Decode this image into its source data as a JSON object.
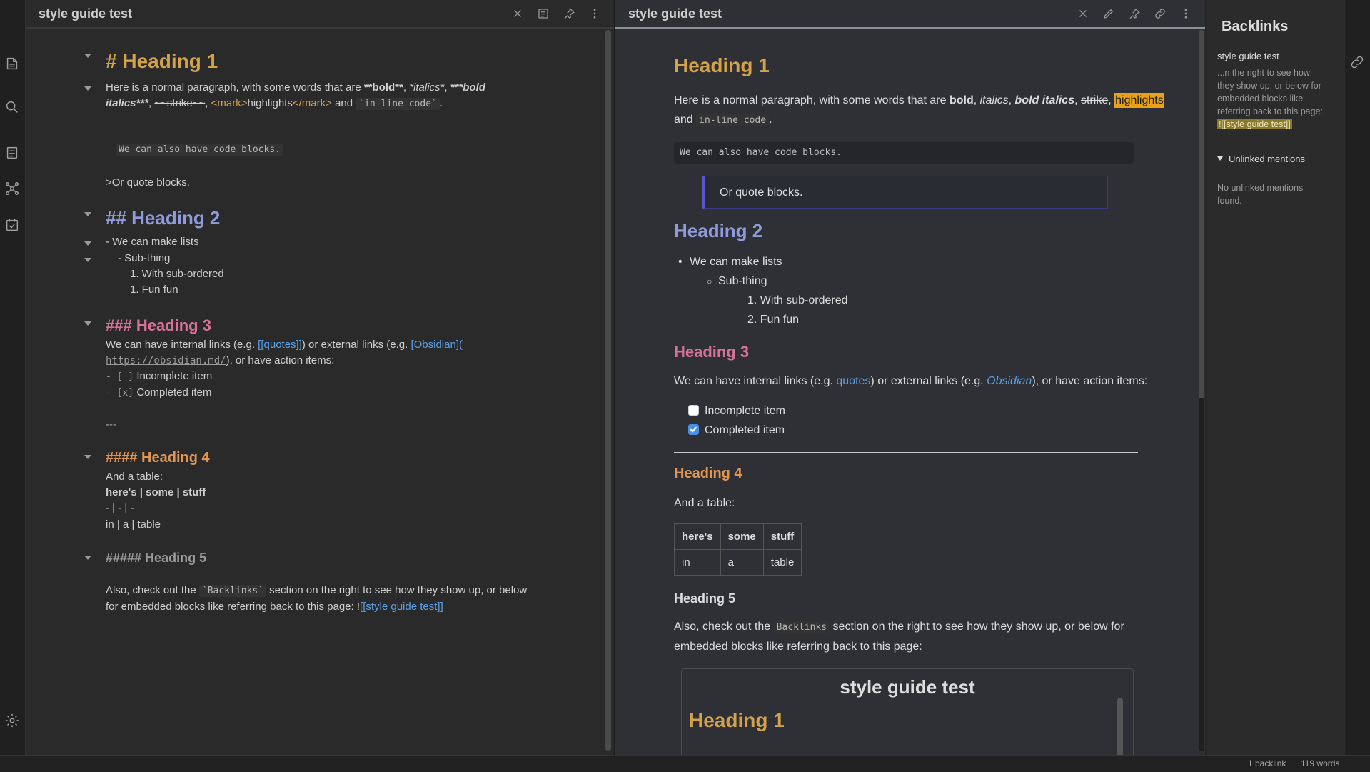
{
  "panes": {
    "left_title": "style guide test",
    "right_title": "style guide test"
  },
  "editor": {
    "h1": "# Heading 1",
    "p1_a": "Here is a normal paragraph, with some words that are ",
    "p1_bold": "**bold**",
    "p1_sep1": ", ",
    "p1_italics": "*italics*",
    "p1_sep2": ", ",
    "p1_bolditalic_1": "***bold",
    "p1_bolditalic_2": "italics***",
    "p1_strike": "~~strike~~",
    "p1_mark_open": "<mark>",
    "p1_mark_text": "highlights",
    "p1_mark_close": "</mark>",
    "p1_and": " and ",
    "p1_code": "`in-line code`",
    "p1_end": ".",
    "code_block": "We can also have code blocks.",
    "quote": ">Or quote blocks.",
    "h2": "## Heading 2",
    "list1": "- We can make lists",
    "list2": "- Sub-thing",
    "list3": "1. With sub-ordered",
    "list4": "1. Fun fun",
    "h3": "### Heading 3",
    "links_a": "We can have internal links (e.g. ",
    "links_internal": "[[quotes]]",
    "links_b": ") or external links (e.g. ",
    "links_external": "[Obsidian](",
    "links_url": "https://obsidian.md/",
    "links_c": "), or have action items:",
    "task1_box": "- [ ]",
    "task1": "Incomplete item",
    "task2_box": "- [x]",
    "task2": "Completed item",
    "hr": "---",
    "h4": "#### Heading 4",
    "table_intro": "And a table:",
    "table_row1": "here's | some | stuff",
    "table_row2": "- | - | -",
    "table_row3": "in | a | table",
    "h5": "##### Heading 5",
    "backlinks_a": "Also, check out the ",
    "backlinks_code": "`Backlinks`",
    "backlinks_b": " section on the right to see how they show up, or below",
    "backlinks_c": "for embedded blocks like referring back to this page: !",
    "backlinks_link": "[[style guide test]]"
  },
  "preview": {
    "h1": "Heading 1",
    "p1_a": "Here is a normal paragraph, with some words that are ",
    "p1_bold": "bold",
    "p1_italics": "italics",
    "p1_bolditalic": "bold italics",
    "p1_strike": "strike",
    "p1_mark": "highlights",
    "p1_and": "and ",
    "p1_code": "in-line code",
    "code_block": "We can also have code blocks.",
    "quote": "Or quote blocks.",
    "h2": "Heading 2",
    "list1": "We can make lists",
    "list2": "Sub-thing",
    "list3": "1. With sub-ordered",
    "list4": "2. Fun fun",
    "h3": "Heading 3",
    "links_a": "We can have internal links (e.g. ",
    "links_internal": "quotes",
    "links_b": ") or external links (e.g. ",
    "links_external": "Obsidian",
    "links_c": "), or have action items:",
    "task1": "Incomplete item",
    "task2": "Completed item",
    "h4": "Heading 4",
    "table_intro": "And a table:",
    "table_headers": [
      "here's",
      "some",
      "stuff"
    ],
    "table_row": [
      "in",
      "a",
      "table"
    ],
    "h5": "Heading 5",
    "backlinks_a": "Also, check out the ",
    "backlinks_code": "Backlinks",
    "backlinks_b": " section on the right to see how they show up, or below for",
    "backlinks_c": "embedded blocks like referring back to this page:",
    "embed_title": "style guide test",
    "embed_h1": "Heading 1"
  },
  "backlinks": {
    "title": "Backlinks",
    "file": "style guide test",
    "snippet_1": "...n the right to see how",
    "snippet_2": "they show up, or below for",
    "snippet_3": "embedded blocks like",
    "snippet_4": "referring back to this page:",
    "snippet_mark": "![[style guide test]]",
    "unlinked_label": "Unlinked mentions",
    "unlinked_empty_1": "No unlinked mentions",
    "unlinked_empty_2": "found."
  },
  "status": {
    "backlinks": "1 backlink",
    "words": "119 words"
  }
}
